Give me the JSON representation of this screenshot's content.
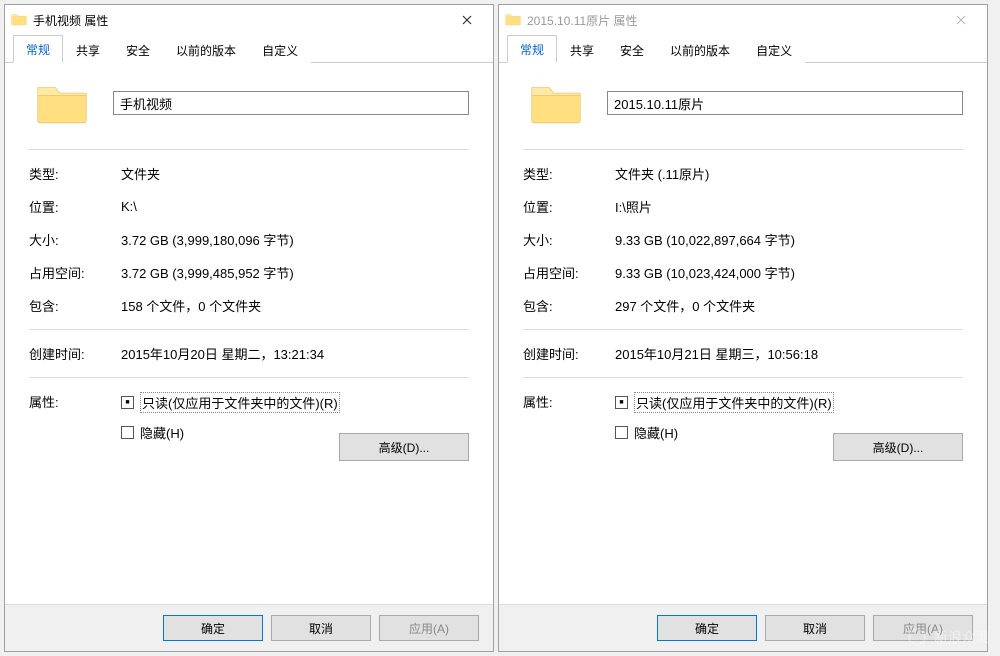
{
  "dialogs": [
    {
      "active": true,
      "title": "手机视频 属性",
      "name_value": "手机视频",
      "type_label": "类型:",
      "type_value": "文件夹",
      "location_label": "位置:",
      "location_value": "K:\\",
      "size_label": "大小:",
      "size_value": "3.72 GB (3,999,180,096 字节)",
      "ondisk_label": "占用空间:",
      "ondisk_value": "3.72 GB (3,999,485,952 字节)",
      "contains_label": "包含:",
      "contains_value": "158 个文件，0 个文件夹",
      "created_label": "创建时间:",
      "created_value": "2015年10月20日 星期二，13:21:34",
      "attr_label": "属性:",
      "readonly_label": "只读(仅应用于文件夹中的文件)(R)",
      "hidden_label": "隐藏(H)",
      "advanced_label": "高级(D)..."
    },
    {
      "active": false,
      "title": "2015.10.11原片 属性",
      "name_value": "2015.10.11原片",
      "type_label": "类型:",
      "type_value": "文件夹 (.11原片)",
      "location_label": "位置:",
      "location_value": "I:\\照片",
      "size_label": "大小:",
      "size_value": "9.33 GB (10,022,897,664 字节)",
      "ondisk_label": "占用空间:",
      "ondisk_value": "9.33 GB (10,023,424,000 字节)",
      "contains_label": "包含:",
      "contains_value": "297 个文件，0 个文件夹",
      "created_label": "创建时间:",
      "created_value": "2015年10月21日 星期三，10:56:18",
      "attr_label": "属性:",
      "readonly_label": "只读(仅应用于文件夹中的文件)(R)",
      "hidden_label": "隐藏(H)",
      "advanced_label": "高级(D)..."
    }
  ],
  "tabs": [
    "常规",
    "共享",
    "安全",
    "以前的版本",
    "自定义"
  ],
  "buttons": {
    "ok": "确定",
    "cancel": "取消",
    "apply": "应用(A)"
  },
  "watermark": "新浪众测"
}
